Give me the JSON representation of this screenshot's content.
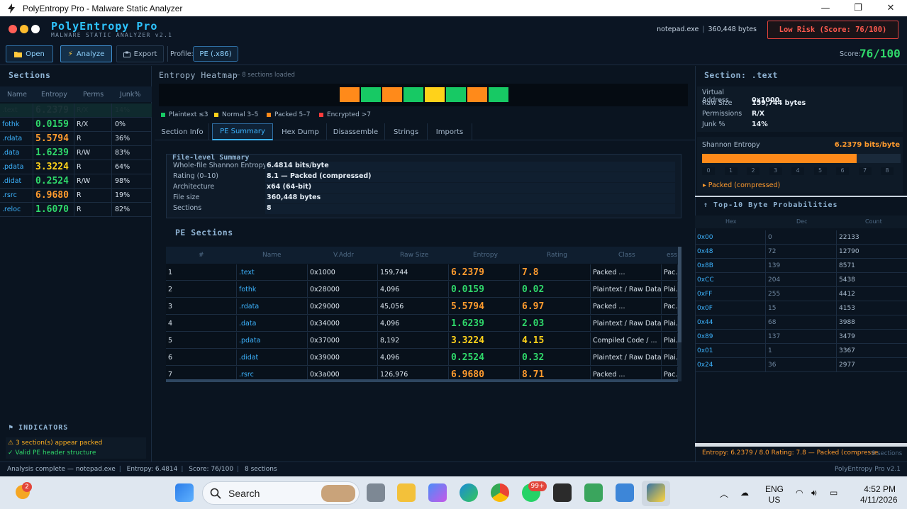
{
  "window": {
    "title": "PolyEntropy Pro - Malware Static Analyzer",
    "minimize": "—",
    "maximize": "❐",
    "close": "✕"
  },
  "header": {
    "app_name": "PolyEntropy Pro",
    "subtitle": "MALWARE STATIC ANALYZER v2.1",
    "file_name": "notepad.exe",
    "file_size": "360,448 bytes",
    "risk_badge": "Low Risk (Score: 76/100)",
    "dots": [
      "#ff5f57",
      "#febc2e",
      "#ffffff"
    ]
  },
  "toolbar": {
    "open_label": "Open",
    "analyze_label": "Analyze",
    "export_label": "Export",
    "profile_label": "Profile:",
    "profile_value": "PE (.x86)",
    "score_label": "Score:",
    "score_value": "76/100"
  },
  "sections_panel": {
    "title": "Sections",
    "columns": [
      "Name",
      "Entropy",
      "Perms",
      "Junk%"
    ],
    "rows": [
      {
        "name": ".text",
        "entropy": "6.2379",
        "perms": "R/X",
        "junk": "14%",
        "color": "#ff9b2e"
      },
      {
        "name": "fothk",
        "entropy": "0.0159",
        "perms": "R/X",
        "junk": "0%",
        "color": "#2fd86a"
      },
      {
        "name": ".rdata",
        "entropy": "5.5794",
        "perms": "R",
        "junk": "36%",
        "color": "#ff9b2e"
      },
      {
        "name": ".data",
        "entropy": "1.6239",
        "perms": "R/W",
        "junk": "83%",
        "color": "#2fd86a"
      },
      {
        "name": ".pdata",
        "entropy": "3.3224",
        "perms": "R",
        "junk": "64%",
        "color": "#ffd21a"
      },
      {
        "name": ".didat",
        "entropy": "0.2524",
        "perms": "R/W",
        "junk": "98%",
        "color": "#2fd86a"
      },
      {
        "name": ".rsrc",
        "entropy": "6.9680",
        "perms": "R",
        "junk": "19%",
        "color": "#ff9b2e"
      },
      {
        "name": ".reloc",
        "entropy": "1.6070",
        "perms": "R",
        "junk": "82%",
        "color": "#2fd86a"
      }
    ]
  },
  "indicators": {
    "title": "INDICATORS",
    "items": [
      {
        "icon": "⚠",
        "text": "3 section(s) appear packed",
        "color": "#ffb020"
      },
      {
        "icon": "✓",
        "text": "Valid PE header structure",
        "color": "#2fd86a"
      }
    ]
  },
  "heatmap": {
    "title": "Entropy Heatmap",
    "subtitle": "— 8 sections loaded",
    "cells": [
      "#ff8a1a",
      "#17c964",
      "#ff8a1a",
      "#17c964",
      "#ffd21a",
      "#17c964",
      "#ff8a1a",
      "#17c964"
    ],
    "legend": [
      {
        "label": "Plaintext ≤3",
        "color": "#17c964"
      },
      {
        "label": "Normal 3–5",
        "color": "#ffd21a"
      },
      {
        "label": "Packed 5–7",
        "color": "#ff8a1a"
      },
      {
        "label": "Encrypted >7",
        "color": "#ff3b3b"
      }
    ]
  },
  "tabs": [
    "Section Info",
    "PE Summary",
    "Hex Dump",
    "Disassemble",
    "Strings",
    "Imports"
  ],
  "summary": {
    "title": "File-level Summary",
    "rows": [
      {
        "key": "Whole-file Shannon Entropy",
        "value": "6.4814 bits/byte"
      },
      {
        "key": "Rating (0–10)",
        "value": "8.1 — Packed (compressed)"
      },
      {
        "key": "Architecture",
        "value": "x64 (64-bit)"
      },
      {
        "key": "File size",
        "value": "360,448 bytes"
      },
      {
        "key": "Sections",
        "value": "8"
      }
    ]
  },
  "pe_sections": {
    "title": "PE Sections",
    "columns": [
      "#",
      "Name",
      "V.Addr",
      "Raw Size",
      "Entropy",
      "Rating",
      "Class",
      "ess"
    ],
    "rows": [
      {
        "n": "1",
        "name": ".text",
        "vaddr": "0x1000",
        "raw": "159,744",
        "entropy": "6.2379",
        "rating": "7.8",
        "cls": "Packed ...",
        "extra": "Pac...",
        "color": "#ff9b2e"
      },
      {
        "n": "2",
        "name": "fothk",
        "vaddr": "0x28000",
        "raw": "4,096",
        "entropy": "0.0159",
        "rating": "0.02",
        "cls": "Plaintext / Raw Data",
        "extra": "Plai...",
        "color": "#2fd86a"
      },
      {
        "n": "3",
        "name": ".rdata",
        "vaddr": "0x29000",
        "raw": "45,056",
        "entropy": "5.5794",
        "rating": "6.97",
        "cls": "Packed ...",
        "extra": "Pac...",
        "color": "#ff9b2e"
      },
      {
        "n": "4",
        "name": ".data",
        "vaddr": "0x34000",
        "raw": "4,096",
        "entropy": "1.6239",
        "rating": "2.03",
        "cls": "Plaintext / Raw Data",
        "extra": "Plai...",
        "color": "#2fd86a"
      },
      {
        "n": "5",
        "name": ".pdata",
        "vaddr": "0x37000",
        "raw": "8,192",
        "entropy": "3.3224",
        "rating": "4.15",
        "cls": "Compiled Code / ...",
        "extra": "Plai...",
        "color": "#ffd21a"
      },
      {
        "n": "6",
        "name": ".didat",
        "vaddr": "0x39000",
        "raw": "4,096",
        "entropy": "0.2524",
        "rating": "0.32",
        "cls": "Plaintext / Raw Data",
        "extra": "Plai...",
        "color": "#2fd86a"
      },
      {
        "n": "7",
        "name": ".rsrc",
        "vaddr": "0x3a000",
        "raw": "126,976",
        "entropy": "6.9680",
        "rating": "8.71",
        "cls": "Packed ...",
        "extra": "Pac...",
        "color": "#ff9b2e"
      }
    ]
  },
  "detail": {
    "title": "Section: .text",
    "rows": [
      {
        "key": "Virtual Address",
        "value": "0x1000"
      },
      {
        "key": "Raw Size",
        "value": "159,744 bytes"
      },
      {
        "key": "Permissions",
        "value": "R/X"
      },
      {
        "key": "Junk %",
        "value": "14%"
      }
    ],
    "shannon_label": "Shannon Entropy",
    "shannon_value": "6.2379 bits/byte",
    "shannon_fraction": 0.7797,
    "scale": [
      "0",
      "1",
      "2",
      "3",
      "4",
      "5",
      "6",
      "7",
      "8"
    ],
    "status": "▸ Packed (compressed)",
    "top_title": "↑ Top-10 Byte Probabilities",
    "byte_columns": [
      "Hex",
      "Dec",
      "Count"
    ],
    "bytes": [
      {
        "hex": "0x00",
        "dec": "0",
        "count": "22133"
      },
      {
        "hex": "0x48",
        "dec": "72",
        "count": "12790"
      },
      {
        "hex": "0x8B",
        "dec": "139",
        "count": "8571"
      },
      {
        "hex": "0xCC",
        "dec": "204",
        "count": "5438"
      },
      {
        "hex": "0xFF",
        "dec": "255",
        "count": "4412"
      },
      {
        "hex": "0x0F",
        "dec": "15",
        "count": "4153"
      },
      {
        "hex": "0x44",
        "dec": "68",
        "count": "3988"
      },
      {
        "hex": "0x89",
        "dec": "137",
        "count": "3479"
      },
      {
        "hex": "0x01",
        "dec": "1",
        "count": "3367"
      },
      {
        "hex": "0x24",
        "dec": "36",
        "count": "2977"
      }
    ],
    "footer": "Entropy: 6.2379 / 8.0   Rating: 7.8 — Packed (compresse",
    "footer_count": "8 sections"
  },
  "statusbar": {
    "status": "Analysis complete — notepad.exe",
    "entropy": "Entropy: 6.4814",
    "score": "Score: 76/100",
    "sections": "8 sections",
    "version": "PolyEntropy Pro v2.1"
  },
  "taskbar": {
    "search": "Search",
    "badge_left": "2",
    "badge_whatsapp": "99+",
    "lang1": "ENG",
    "lang2": "US",
    "time": "4:52 PM",
    "date": "4/11/2026"
  }
}
